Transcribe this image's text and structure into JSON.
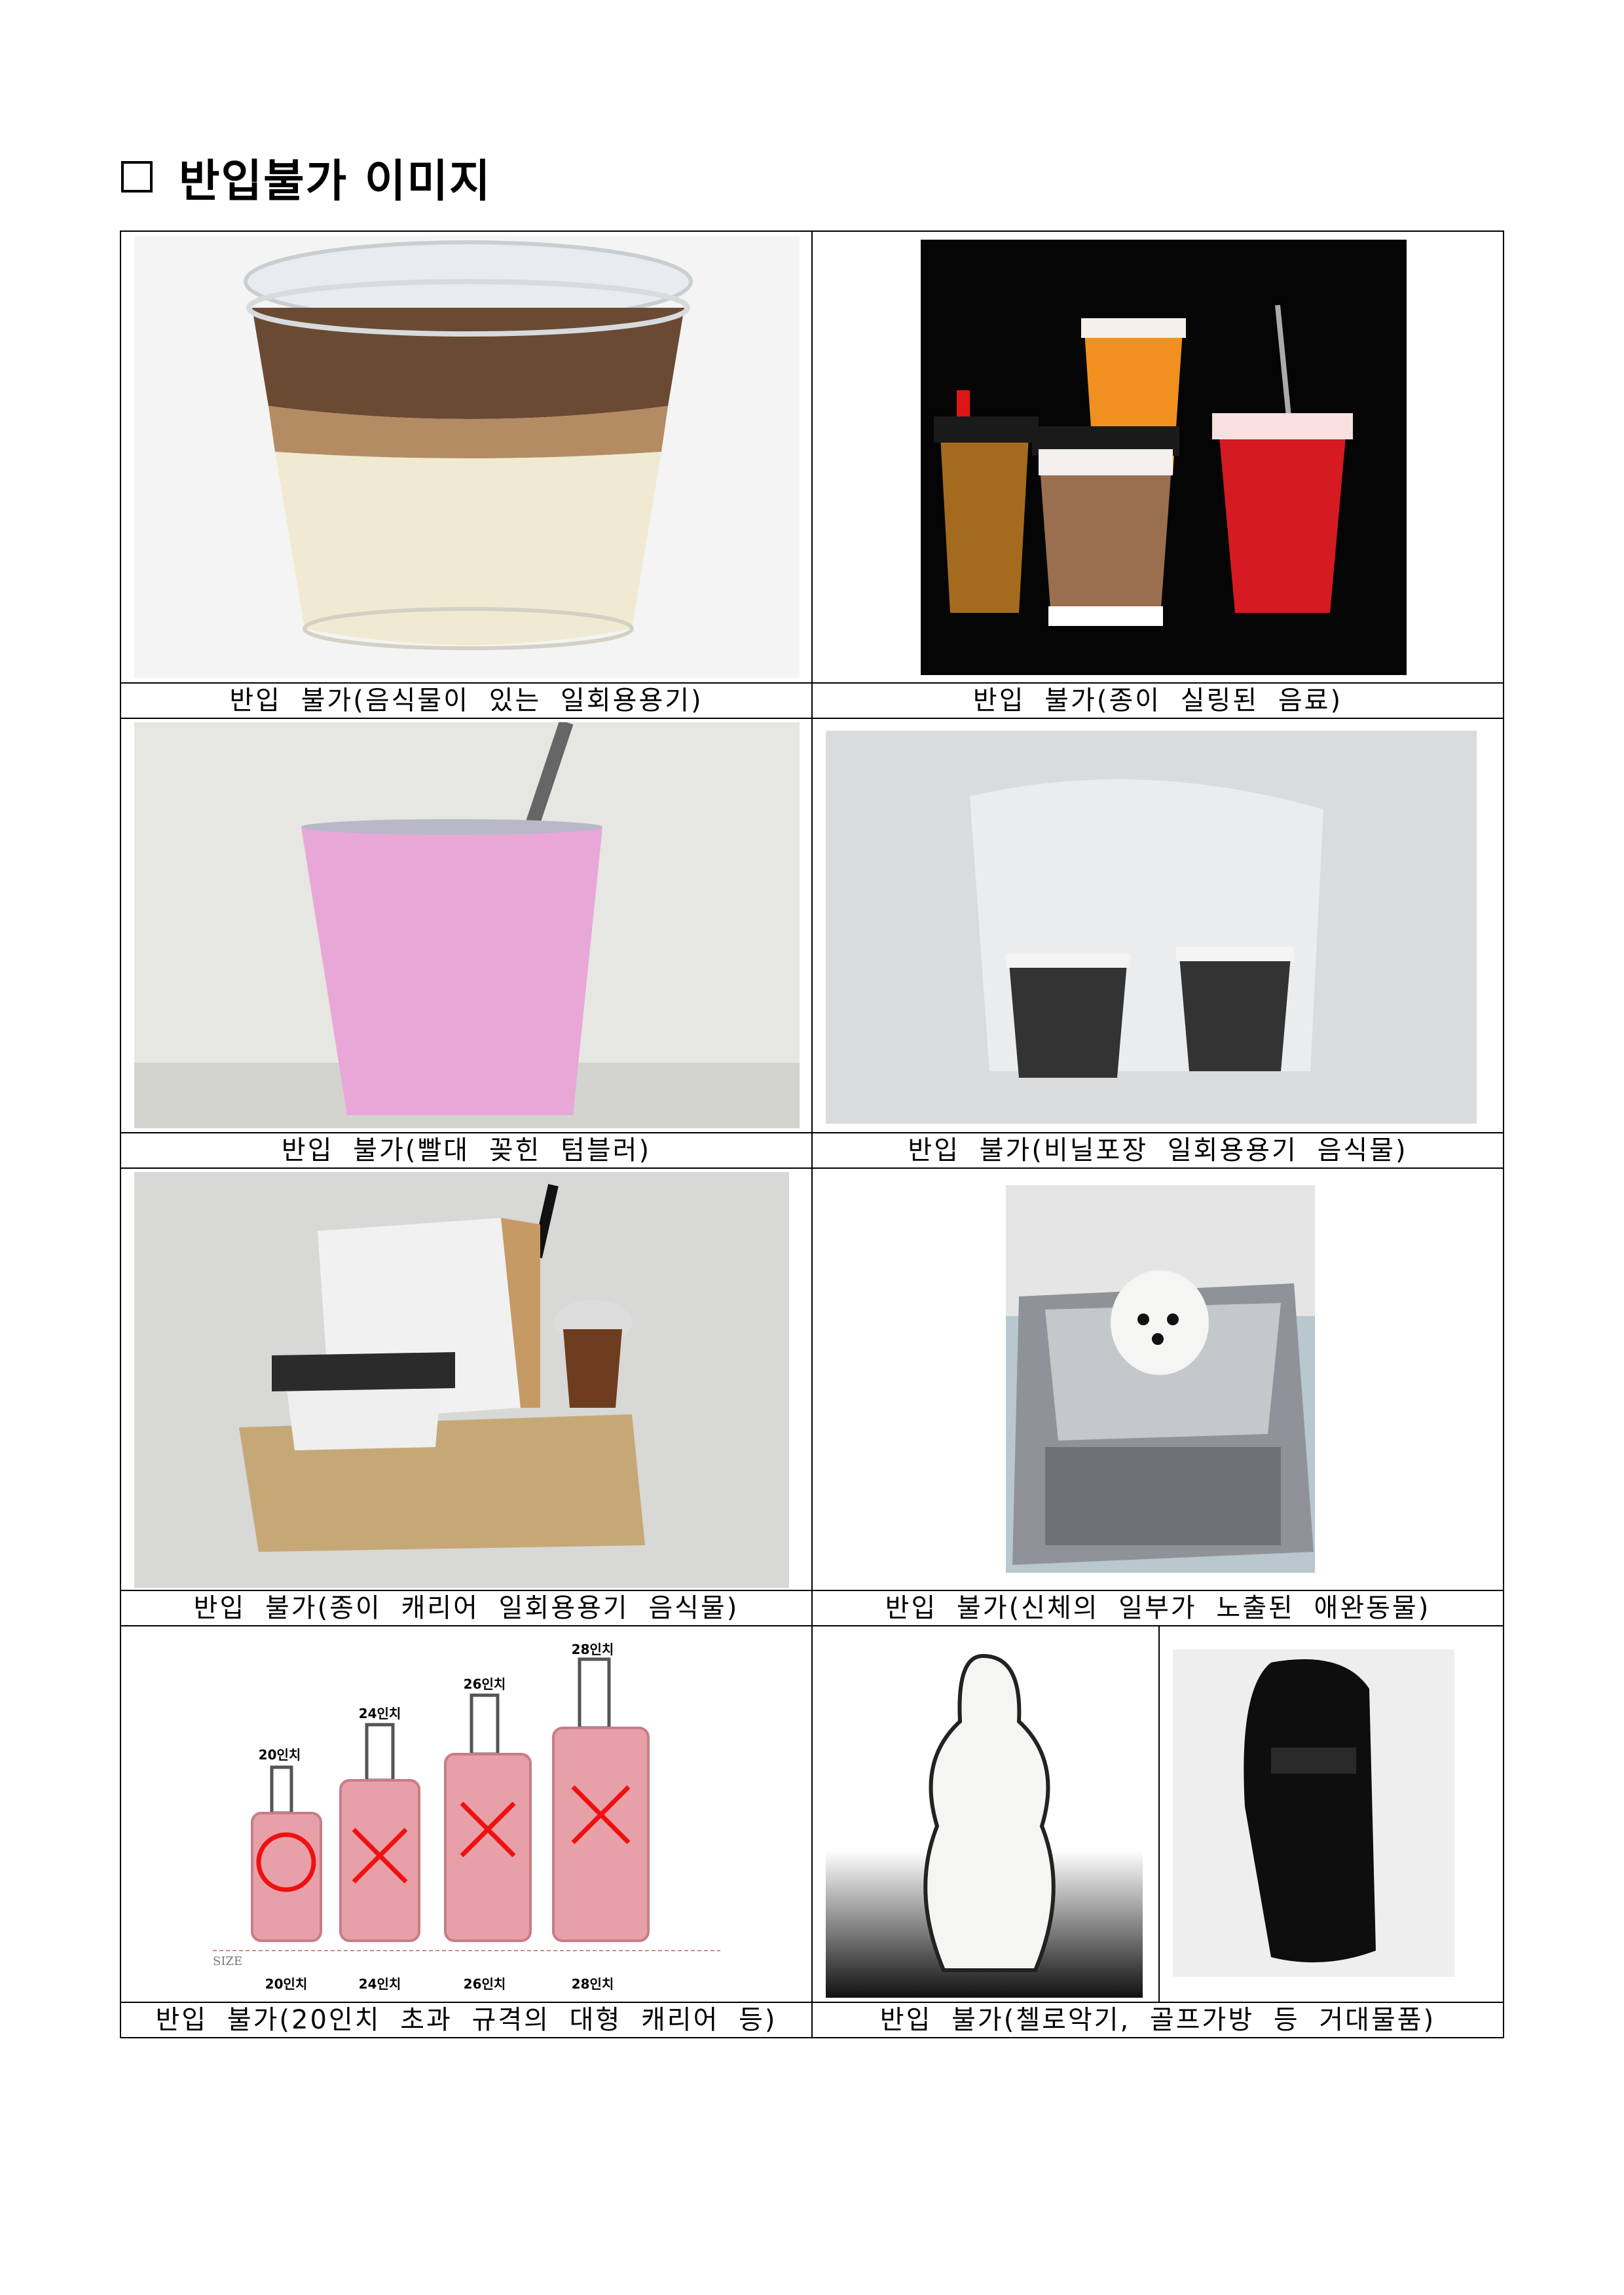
{
  "title": "반입불가 이미지",
  "items": [
    {
      "caption": "반입 불가(음식물이 있는 일회용용기)",
      "icon": "iced-coffee-cup-icon"
    },
    {
      "caption": "반입 불가(종이 실링된 음료)",
      "icon": "sealed-drinks-icon"
    },
    {
      "caption": "반입 불가(빨대 꽂힌 텀블러)",
      "icon": "tumbler-with-straw-icon"
    },
    {
      "caption": "반입 불가(비닐포장 일회용용기 음식물)",
      "icon": "bagged-cups-icon"
    },
    {
      "caption": "반입 불가(종이 캐리어 일회용용기 음식물)",
      "icon": "paper-cup-carrier-icon"
    },
    {
      "caption": "반입 불가(신체의 일부가 노출된 애완동물)",
      "icon": "pet-carrier-dog-icon"
    },
    {
      "caption": "반입 불가(20인치 초과 규격의 대형 캐리어 등)",
      "icon": "luggage-sizes-icon"
    },
    {
      "caption": "반입 불가(첼로악기, 골프가방 등 거대물품)",
      "icon": "cello-case-golf-bag-icon"
    }
  ],
  "luggage": {
    "top_labels": [
      "20인치",
      "24인치",
      "26인치",
      "28인치"
    ],
    "bottom_labels": [
      "20인치",
      "24인치",
      "26인치",
      "28인치"
    ],
    "size_label": "SIZE"
  }
}
